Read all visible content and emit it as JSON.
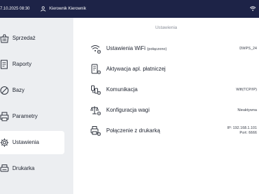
{
  "header": {
    "datetime": "7.10.2025 08:30",
    "user": "Kierownik Kierownik",
    "background": "#1d2347"
  },
  "sidebar": {
    "items": [
      {
        "label": "Sprzedaż",
        "icon": "basket-icon"
      },
      {
        "label": "Raporty",
        "icon": "report-icon"
      },
      {
        "label": "Bazy",
        "icon": "database-icon"
      },
      {
        "label": "Parametry",
        "icon": "printer-params-icon"
      },
      {
        "label": "Ustawienia",
        "icon": "gear-icon",
        "active": true
      },
      {
        "label": "Drukarka",
        "icon": "printer-icon"
      }
    ]
  },
  "main": {
    "heading": "Ustawienia",
    "rows": [
      {
        "label": "Ustawienia WiFi",
        "sublabel": "(połączono)",
        "value": "DWPS_24",
        "icon": "wifi-settings-icon"
      },
      {
        "label": "Aktywacja apl. płatniczej",
        "icon": "payment-app-icon"
      },
      {
        "label": "Komunikacja",
        "value": "Wifi(TCP/IP)",
        "icon": "communication-icon"
      },
      {
        "label": "Konfiguracja wagi",
        "value": "Nieaktywna",
        "icon": "scale-icon"
      },
      {
        "label": "Połączenie z drukarką",
        "value": "IP: 192.168.1.101",
        "value2": "Port: 6666",
        "icon": "printer-connection-icon"
      }
    ]
  }
}
